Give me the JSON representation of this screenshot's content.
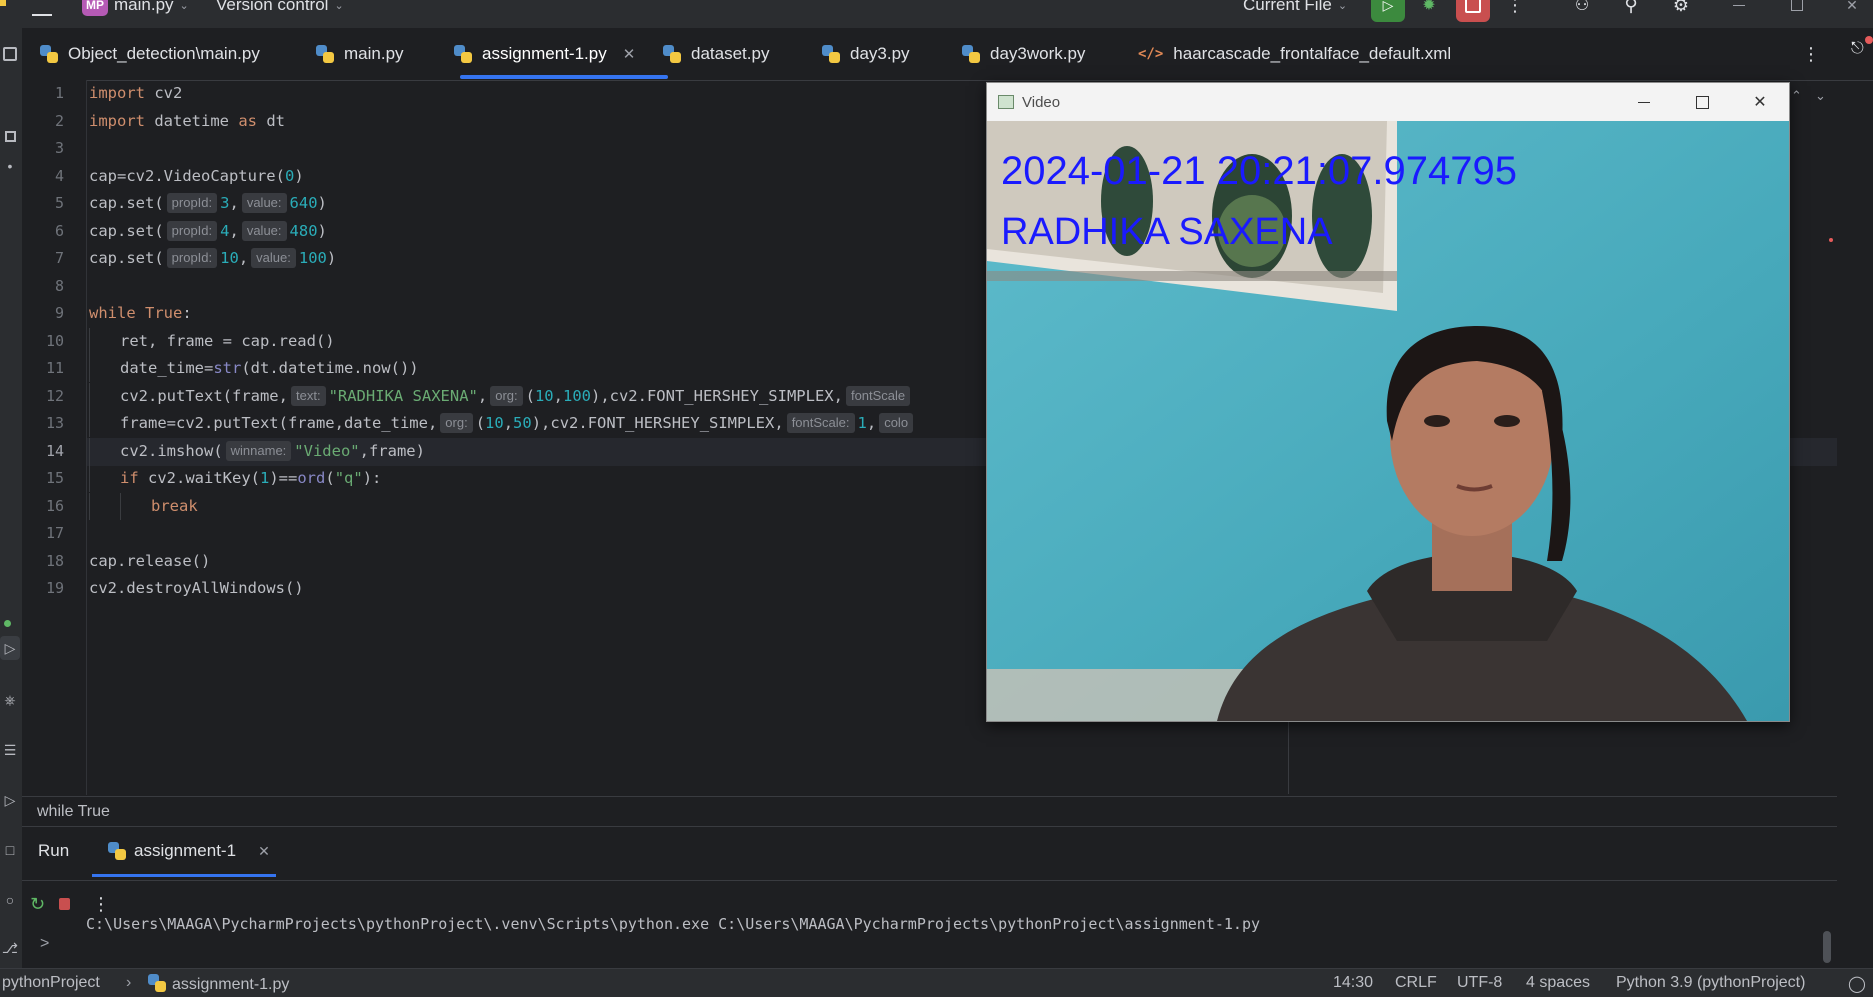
{
  "toolbar": {
    "project_badge": "MP",
    "project_name": "main.py",
    "vcs_label": "Version control",
    "run_config": "Current File"
  },
  "tabs": [
    {
      "label": "Object_detection\\main.py",
      "icon": "python-file-icon"
    },
    {
      "label": "main.py",
      "icon": "python-file-icon"
    },
    {
      "label": "assignment-1.py",
      "icon": "python-file-icon",
      "active": true
    },
    {
      "label": "dataset.py",
      "icon": "python-file-icon"
    },
    {
      "label": "day3.py",
      "icon": "python-file-icon"
    },
    {
      "label": "day3work.py",
      "icon": "python-file-icon"
    },
    {
      "label": "haarcascade_frontalface_default.xml",
      "icon": "xml-file-icon"
    }
  ],
  "editor": {
    "line_numbers": [
      "1",
      "2",
      "3",
      "4",
      "5",
      "6",
      "7",
      "8",
      "9",
      "10",
      "11",
      "12",
      "13",
      "14",
      "15",
      "16",
      "17",
      "18",
      "19"
    ],
    "current_line": "14",
    "code": {
      "l1": {
        "kw": "import",
        "rest": " cv2"
      },
      "l2": {
        "kw": "import",
        "mid": " datetime ",
        "kw2": "as",
        "rest": " dt"
      },
      "l4": {
        "a": "cap=cv2.VideoCapture(",
        "n": "0",
        "b": ")"
      },
      "l5": {
        "a": "cap.set(",
        "h1": "propId:",
        "n1": "3",
        "h2": "value:",
        "n2": "640",
        "b": ")"
      },
      "l6": {
        "a": "cap.set(",
        "h1": "propId:",
        "n1": "4",
        "h2": "value:",
        "n2": "480",
        "b": ")"
      },
      "l7": {
        "a": "cap.set(",
        "h1": "propId:",
        "n1": "10",
        "h2": "value:",
        "n2": "100",
        "b": ")"
      },
      "l9": {
        "kw": "while",
        "kw2": "True",
        "b": ":"
      },
      "l10": {
        "a": "ret, frame = cap.read()"
      },
      "l11": {
        "a": "date_time=",
        "bi": "str",
        "b": "(dt.datetime.now())"
      },
      "l12": {
        "a": "cv2.putText(frame,",
        "h1": "text:",
        "s": "\"RADHIKA SAXENA\"",
        "c": ",",
        "h2": "org:",
        "d": "(",
        "n1": "10",
        "e": ",",
        "n2": "100",
        "f": "),cv2.FONT_HERSHEY_SIMPLEX,",
        "h3": "fontScale"
      },
      "l13": {
        "a": "frame=cv2.putText(frame,date_time,",
        "h1": "org:",
        "d": "(",
        "n1": "10",
        "e": ",",
        "n2": "50",
        "f": "),cv2.FONT_HERSHEY_SIMPLEX,",
        "h2": "fontScale:",
        "n3": "1",
        "g": ",",
        "h3": "colo"
      },
      "l14": {
        "a": "cv2.imshow(",
        "h1": "winname:",
        "s": "\"Video\"",
        "b": ",frame)"
      },
      "l15": {
        "kw": "if",
        "a": " cv2.waitKey(",
        "n": "1",
        "b": ")==",
        "bi": "ord",
        "c": "(",
        "s": "\"q\"",
        "d": "):"
      },
      "l16": {
        "kw": "break"
      },
      "l18": {
        "a": "cap.release()"
      },
      "l19": {
        "a": "cv2.destroyAllWindows()"
      }
    },
    "breadcrumb": "while True"
  },
  "video_window": {
    "title": "Video",
    "overlay_datetime": "2024-01-21 20:21:07.974795",
    "overlay_name": "RADHIKA SAXENA"
  },
  "run_panel": {
    "tab_run": "Run",
    "tab_config": "assignment-1",
    "output": "C:\\Users\\MAAGA\\PycharmProjects\\pythonProject\\.venv\\Scripts\\python.exe C:\\Users\\MAAGA\\PycharmProjects\\pythonProject\\assignment-1.py",
    "prompt": ">"
  },
  "status_bar": {
    "project": "pythonProject",
    "file": "assignment-1.py",
    "position": "14:30",
    "line_sep": "CRLF",
    "encoding": "UTF-8",
    "indent": "4 spaces",
    "interpreter": "Python 3.9 (pythonProject)"
  }
}
